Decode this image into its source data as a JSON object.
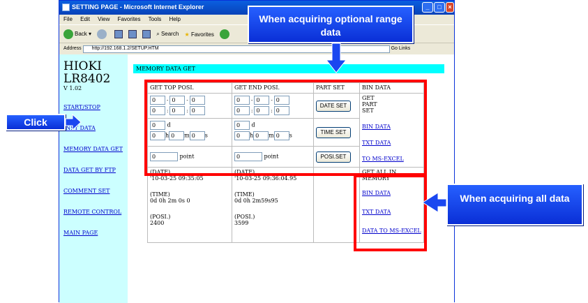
{
  "browser": {
    "title": "SETTING PAGE - Microsoft Internet Explorer",
    "menu": [
      "File",
      "Edit",
      "View",
      "Favorites",
      "Tools",
      "Help"
    ],
    "toolbar": {
      "back": "Back",
      "search": "Search",
      "favorites": "Favorites"
    },
    "address_label": "Address",
    "url": "http://192.168.1.2/SETUP.HTM",
    "go": "Go",
    "links": "Links"
  },
  "sidebar": {
    "brand": "HIOKI",
    "model": "LR8402",
    "version": "V 1.02",
    "items": [
      {
        "label": "START/STOP"
      },
      {
        "label": "INST DATA"
      },
      {
        "label": "MEMORY DATA GET"
      },
      {
        "label": "DATA GET BY FTP"
      },
      {
        "label": "COMMENT SET"
      },
      {
        "label": "REMOTE CONTROL"
      },
      {
        "label": "MAIN PAGE"
      }
    ]
  },
  "page": {
    "banner": "MEMORY DATA GET",
    "headers": [
      "GET TOP POSI.",
      "GET END POSI.",
      "PART SET",
      "BIN DATA"
    ],
    "top_date": [
      "0",
      "0",
      "0",
      "0",
      "0",
      "0"
    ],
    "top_time": {
      "d": "0",
      "h": "0",
      "m": "0",
      "s": "0",
      "unit_d": "d",
      "unit_h": "h",
      "unit_m": "m",
      "unit_s": "s"
    },
    "top_point": "0",
    "end_date": [
      "0",
      "0",
      "0",
      "0",
      "0",
      "0"
    ],
    "end_time": {
      "d": "0",
      "h": "0",
      "m": "0",
      "s": "0"
    },
    "end_point": "0",
    "point_unit": "point",
    "buttons": {
      "date_set": "DATE SET",
      "time_set": "TIME SET",
      "posi_set": "POSI.SET"
    },
    "part_label": "GET PART SET",
    "part_links": [
      "BIN DATA",
      "TXT DATA",
      "TO MS-EXCEL"
    ],
    "info_top": {
      "date_label": "(DATE)",
      "date": "'10-03-25 09:35:05",
      "time_label": "(TIME)",
      "time": "0d 0h 2m 0s 0",
      "posi_label": "(POSI.)",
      "posi": "2400"
    },
    "info_end": {
      "date_label": "(DATE)",
      "date": "'10-03-25 09:36:04.95",
      "time_label": "(TIME)",
      "time": "0d 0h 2m59s95",
      "posi_label": "(POSI.)",
      "posi": "3599"
    },
    "all_label": "GET ALL IN MEMORY",
    "all_links": [
      "BIN DATA",
      "TXT DATA",
      "DATA TO MS-EXCEL"
    ]
  },
  "callouts": {
    "optional": "When acquiring optional range data",
    "all": "When acquiring all data",
    "click": "Click"
  },
  "colors": {
    "annotation_red": "#ff0000",
    "callout_blue": "#1a47f0",
    "banner_cyan": "#00ffff",
    "sidebar_bg": "#ccffff"
  }
}
